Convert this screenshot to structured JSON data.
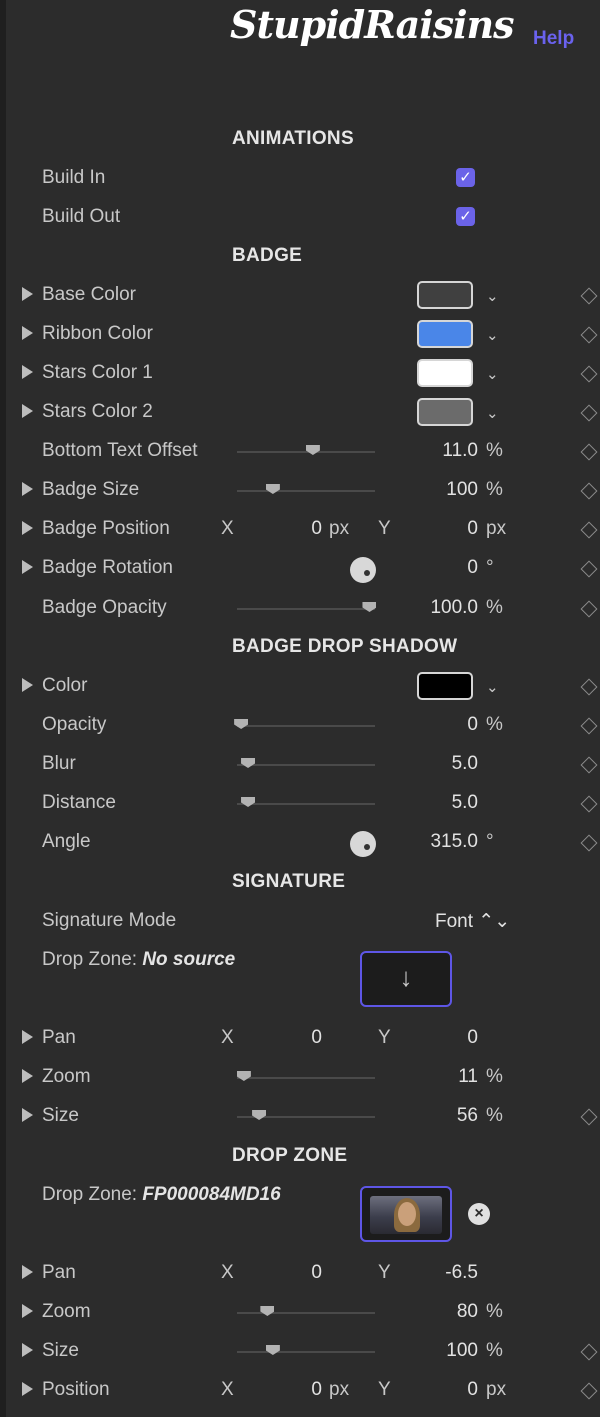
{
  "header": {
    "logo": "StupidRaisins",
    "help": "Help"
  },
  "animations": {
    "title": "ANIMATIONS",
    "build_in": "Build In",
    "build_out": "Build Out",
    "build_in_checked": true,
    "build_out_checked": true
  },
  "badge": {
    "title": "BADGE",
    "base_color": {
      "label": "Base Color",
      "color": "#404040"
    },
    "ribbon_color": {
      "label": "Ribbon Color",
      "color": "#4a86e8"
    },
    "stars_color_1": {
      "label": "Stars Color 1",
      "color": "#ffffff"
    },
    "stars_color_2": {
      "label": "Stars Color 2",
      "color": "#6b6b6b"
    },
    "bottom_text_offset": {
      "label": "Bottom Text Offset",
      "value": "11.0",
      "unit": "%",
      "slider": 0.55
    },
    "badge_size": {
      "label": "Badge Size",
      "value": "100",
      "unit": "%",
      "slider": 0.26
    },
    "badge_position": {
      "label": "Badge Position",
      "x_label": "X",
      "x": "0",
      "x_unit": "px",
      "y_label": "Y",
      "y": "0",
      "y_unit": "px"
    },
    "badge_rotation": {
      "label": "Badge Rotation",
      "value": "0",
      "unit": "°"
    },
    "badge_opacity": {
      "label": "Badge Opacity",
      "value": "100.0",
      "unit": "%",
      "slider": 0.96
    }
  },
  "shadow": {
    "title": "BADGE DROP SHADOW",
    "color": {
      "label": "Color",
      "color": "#000000"
    },
    "opacity": {
      "label": "Opacity",
      "value": "0",
      "unit": "%",
      "slider": 0.03
    },
    "blur": {
      "label": "Blur",
      "value": "5.0",
      "slider": 0.08
    },
    "distance": {
      "label": "Distance",
      "value": "5.0",
      "slider": 0.08
    },
    "angle": {
      "label": "Angle",
      "value": "315.0",
      "unit": "°"
    }
  },
  "signature": {
    "title": "SIGNATURE",
    "mode_label": "Signature Mode",
    "mode_value": "Font ⌃⌄",
    "drop_zone_label": "Drop Zone: ",
    "drop_zone_value": "No source",
    "drop_arrow": "↓",
    "pan": {
      "label": "Pan",
      "x_label": "X",
      "x": "0",
      "y_label": "Y",
      "y": "0"
    },
    "zoom": {
      "label": "Zoom",
      "value": "11",
      "unit": "%",
      "slider": 0.05
    },
    "size": {
      "label": "Size",
      "value": "56",
      "unit": "%",
      "slider": 0.16
    }
  },
  "dropzone": {
    "title": "DROP ZONE",
    "drop_zone_label": "Drop Zone: ",
    "drop_zone_value": "FP000084MD16",
    "remove": "×",
    "pan": {
      "label": "Pan",
      "x_label": "X",
      "x": "0",
      "y_label": "Y",
      "y": "-6.5"
    },
    "zoom": {
      "label": "Zoom",
      "value": "80",
      "unit": "%",
      "slider": 0.22
    },
    "size": {
      "label": "Size",
      "value": "100",
      "unit": "%",
      "slider": 0.26
    },
    "position": {
      "label": "Position",
      "x_label": "X",
      "x": "0",
      "x_unit": "px",
      "y_label": "Y",
      "y": "0",
      "y_unit": "px"
    }
  }
}
